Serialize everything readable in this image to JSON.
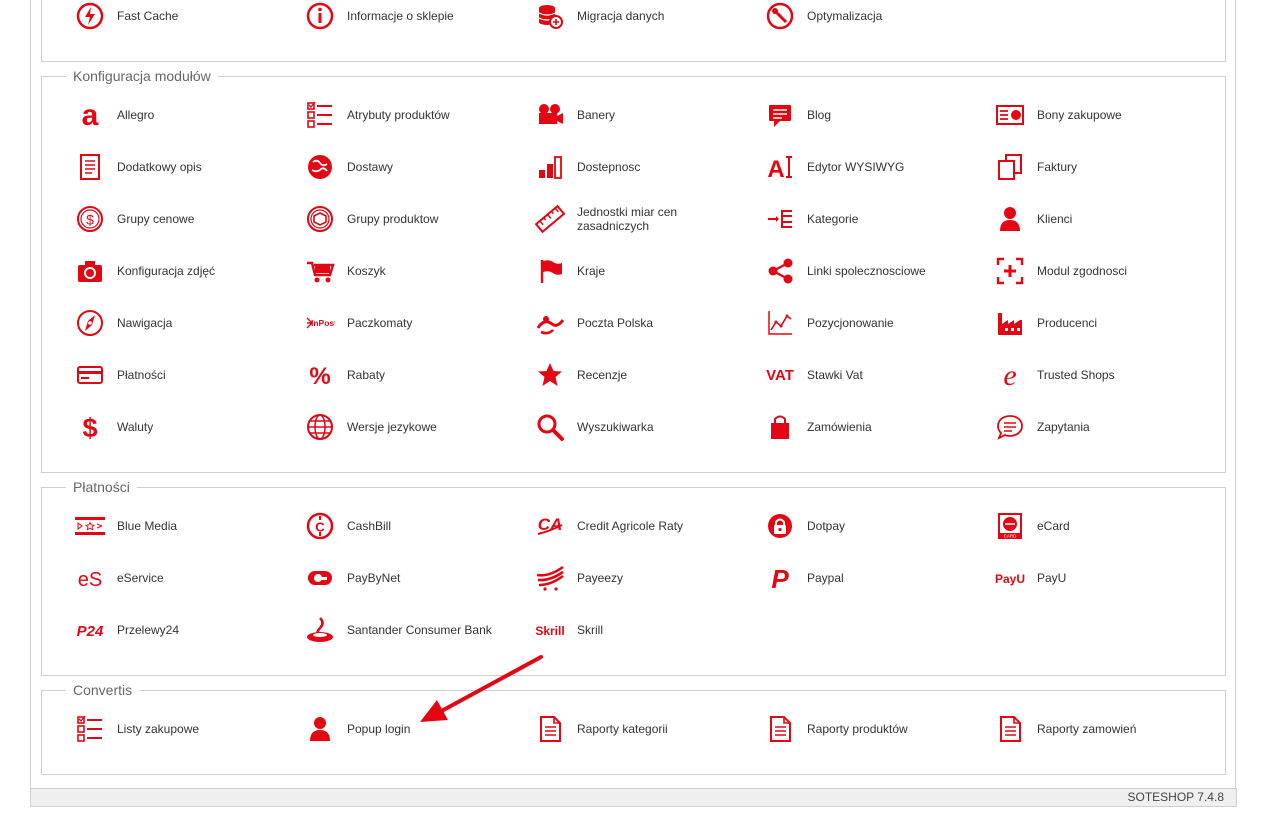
{
  "accent": "#e30613",
  "sections": [
    {
      "legend": "",
      "items": [
        {
          "label": "Fast Cache",
          "icon": "fast-cache-icon"
        },
        {
          "label": "Informacje o sklepie",
          "icon": "info-icon"
        },
        {
          "label": "Migracja danych",
          "icon": "database-migration-icon"
        },
        {
          "label": "Optymalizacja",
          "icon": "optimization-icon"
        }
      ]
    },
    {
      "legend": "Konfiguracja modułów",
      "items": [
        {
          "label": "Allegro",
          "icon": "allegro-icon"
        },
        {
          "label": "Atrybuty produktów",
          "icon": "checklist-icon"
        },
        {
          "label": "Banery",
          "icon": "camera-banner-icon"
        },
        {
          "label": "Blog",
          "icon": "blog-icon"
        },
        {
          "label": "Bony zakupowe",
          "icon": "voucher-icon"
        },
        {
          "label": "Dodatkowy opis",
          "icon": "document-icon"
        },
        {
          "label": "Dostawy",
          "icon": "globe-delivery-icon"
        },
        {
          "label": "Dostepnosc",
          "icon": "availability-bars-icon"
        },
        {
          "label": "Edytor WYSIWYG",
          "icon": "text-editor-icon"
        },
        {
          "label": "Faktury",
          "icon": "copy-invoice-icon"
        },
        {
          "label": "Grupy cenowe",
          "icon": "dollar-circle-icon"
        },
        {
          "label": "Grupy produktow",
          "icon": "product-group-icon"
        },
        {
          "label": "Jednostki miar cen zasadniczych",
          "icon": "ruler-icon"
        },
        {
          "label": "Kategorie",
          "icon": "categories-icon"
        },
        {
          "label": "Klienci",
          "icon": "user-icon"
        },
        {
          "label": "Konfiguracja zdjęć",
          "icon": "photo-camera-icon"
        },
        {
          "label": "Koszyk",
          "icon": "cart-icon"
        },
        {
          "label": "Kraje",
          "icon": "flag-icon"
        },
        {
          "label": "Linki spolecznosciowe",
          "icon": "share-icon"
        },
        {
          "label": "Modul zgodnosci",
          "icon": "compliance-icon"
        },
        {
          "label": "Nawigacja",
          "icon": "compass-icon"
        },
        {
          "label": "Paczkomaty",
          "icon": "inpost-icon"
        },
        {
          "label": "Poczta Polska",
          "icon": "poczta-polska-icon"
        },
        {
          "label": "Pozycjonowanie",
          "icon": "line-chart-icon"
        },
        {
          "label": "Producenci",
          "icon": "factory-icon"
        },
        {
          "label": "Płatności",
          "icon": "credit-card-icon"
        },
        {
          "label": "Rabaty",
          "icon": "percent-icon"
        },
        {
          "label": "Recenzje",
          "icon": "star-icon"
        },
        {
          "label": "Stawki Vat",
          "icon": "vat-icon"
        },
        {
          "label": "Trusted Shops",
          "icon": "trusted-shops-icon"
        },
        {
          "label": "Waluty",
          "icon": "dollar-icon"
        },
        {
          "label": "Wersje jezykowe",
          "icon": "language-globe-icon"
        },
        {
          "label": "Wyszukiwarka",
          "icon": "search-icon"
        },
        {
          "label": "Zamówienia",
          "icon": "shopping-bag-icon"
        },
        {
          "label": "Zapytania",
          "icon": "chat-bubble-icon"
        }
      ]
    },
    {
      "legend": "Płatności",
      "items": [
        {
          "label": "Blue Media",
          "icon": "blue-media-icon"
        },
        {
          "label": "CashBill",
          "icon": "cashbill-icon"
        },
        {
          "label": "Credit Agricole Raty",
          "icon": "credit-agricole-icon"
        },
        {
          "label": "Dotpay",
          "icon": "dotpay-icon"
        },
        {
          "label": "eCard",
          "icon": "ecard-icon"
        },
        {
          "label": "eService",
          "icon": "eservice-icon"
        },
        {
          "label": "PayByNet",
          "icon": "paybynet-icon"
        },
        {
          "label": "Payeezy",
          "icon": "payeezy-icon"
        },
        {
          "label": "Paypal",
          "icon": "paypal-icon"
        },
        {
          "label": "PayU",
          "icon": "payu-icon"
        },
        {
          "label": "Przelewy24",
          "icon": "przelewy24-icon"
        },
        {
          "label": "Santander Consumer Bank",
          "icon": "santander-icon"
        },
        {
          "label": "Skrill",
          "icon": "skrill-icon"
        }
      ]
    },
    {
      "legend": "Convertis",
      "items": [
        {
          "label": "Listy zakupowe",
          "icon": "checklist-icon"
        },
        {
          "label": "Popup login",
          "icon": "user-icon"
        },
        {
          "label": "Raporty kategorii",
          "icon": "report-icon"
        },
        {
          "label": "Raporty produktów",
          "icon": "report-icon"
        },
        {
          "label": "Raporty zamowień",
          "icon": "report-icon"
        }
      ]
    }
  ],
  "footer": {
    "version": "SOTESHOP 7.4.8"
  },
  "logos": {
    "allegro": "a",
    "vat": "VAT",
    "inpost": "InPost",
    "eservice": "eS",
    "payu": "PayU",
    "p24": "P24",
    "skrill": "Skrill",
    "ecard": "CARD",
    "eletter": "e",
    "blue_media": "BLUE MEDIA",
    "paypal": "P",
    "text_editor": "A",
    "percent": "%",
    "dollar": "$"
  }
}
